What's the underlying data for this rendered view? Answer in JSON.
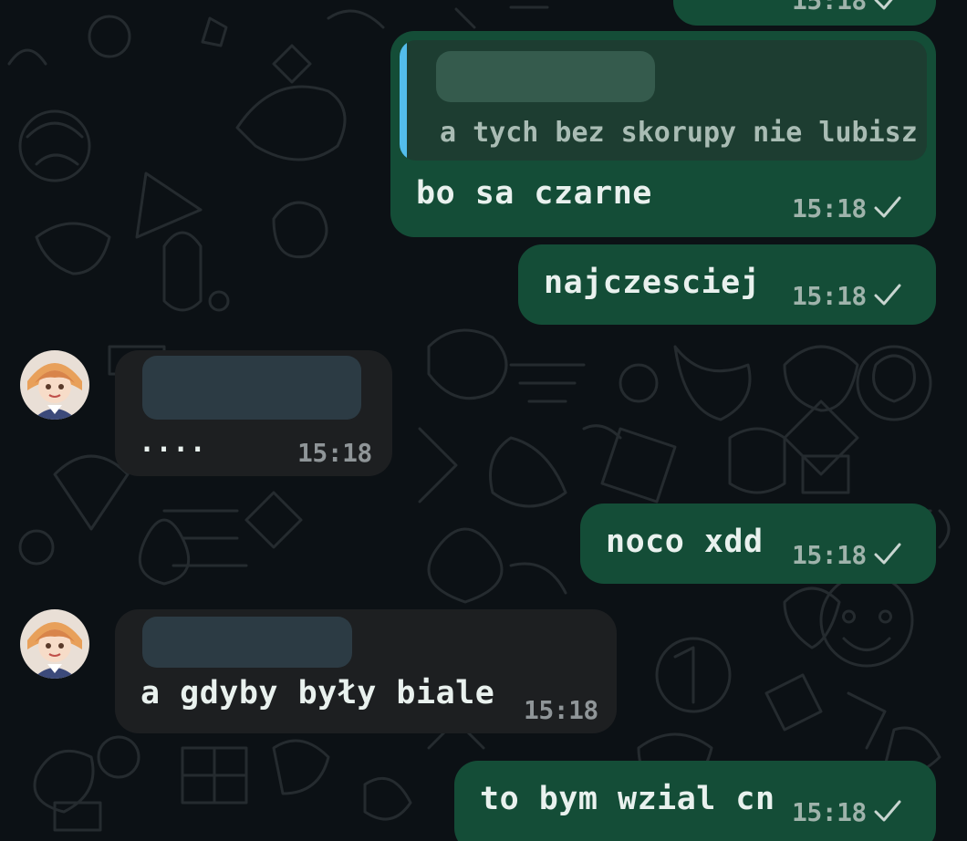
{
  "colors": {
    "background": "#0c1115",
    "outgoing_bubble": "#144d37",
    "incoming_bubble": "#1d1f21",
    "quote_bar": "#53bdeb",
    "text": "#e9f1ee",
    "timestamp": "#9fb3ab"
  },
  "messages": [
    {
      "direction": "outgoing",
      "text": "",
      "time": "15:18",
      "status_icon": "check-icon",
      "partially_visible": true
    },
    {
      "direction": "outgoing",
      "quote": {
        "author": "",
        "text": "a tych bez skorupy nie lubisz"
      },
      "text": "bo sa czarne",
      "time": "15:18",
      "status_icon": "check-icon"
    },
    {
      "direction": "outgoing",
      "text": "najczesciej",
      "time": "15:18",
      "status_icon": "check-icon"
    },
    {
      "direction": "incoming",
      "avatar": "avatar-icon",
      "sender": "",
      "text": "....",
      "time": "15:18"
    },
    {
      "direction": "outgoing",
      "text": "noco xdd",
      "time": "15:18",
      "status_icon": "check-icon"
    },
    {
      "direction": "incoming",
      "avatar": "avatar-icon",
      "sender": "",
      "text": "a gdyby były biale",
      "time": "15:18"
    },
    {
      "direction": "outgoing",
      "text": "to bym wzial cn",
      "time": "15:18",
      "status_icon": "check-icon"
    }
  ]
}
